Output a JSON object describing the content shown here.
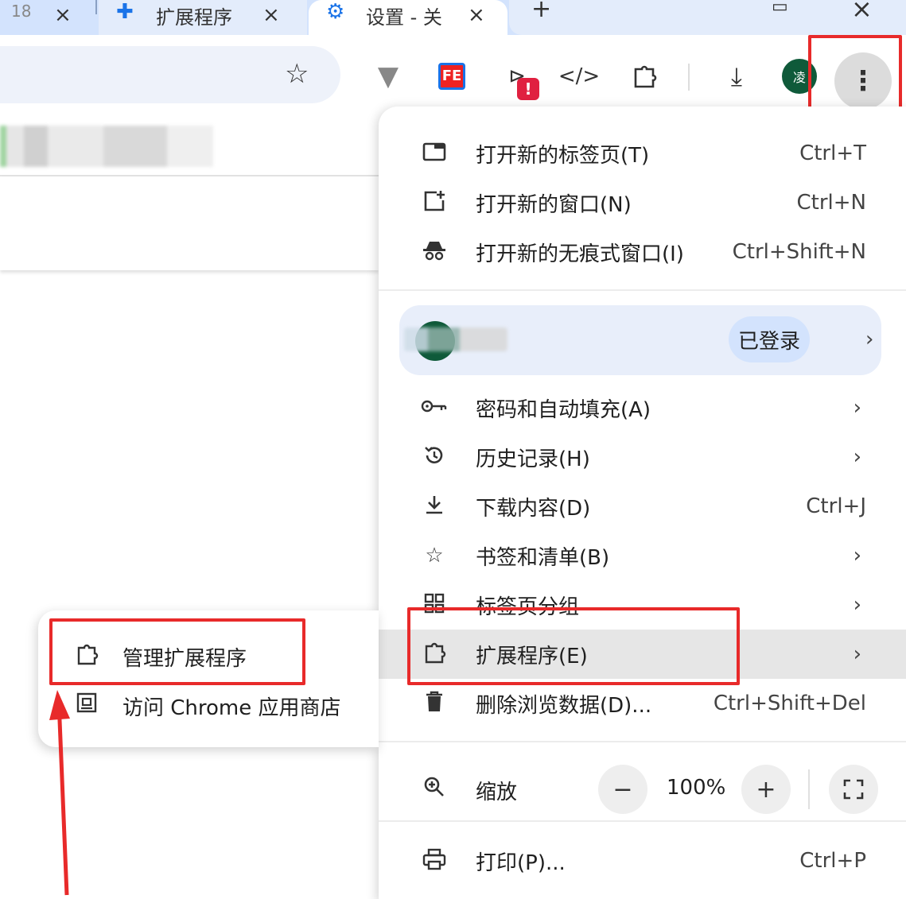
{
  "tabs": [
    {
      "label": "18",
      "close": "×"
    },
    {
      "label": "扩展程序",
      "close": "×"
    },
    {
      "label": "设置 - 关",
      "close": "×"
    }
  ],
  "tabstrip": {
    "new_tab": "+",
    "minimize": "─",
    "close": "×"
  },
  "toolbar": {
    "bookmark_star": "☆",
    "fe_label": "FE",
    "badge": "!",
    "avatar_text": "凌",
    "menu_button": "⋮"
  },
  "menu": {
    "new_tab": {
      "label": "打开新的标签页(T)",
      "shortcut": "Ctrl+T"
    },
    "new_window": {
      "label": "打开新的窗口(N)",
      "shortcut": "Ctrl+N"
    },
    "incognito": {
      "label": "打开新的无痕式窗口(I)",
      "shortcut": "Ctrl+Shift+N"
    },
    "profile": {
      "status": "已登录",
      "arrow": "›"
    },
    "passwords": {
      "label": "密码和自动填充(A)",
      "arrow": "›"
    },
    "history": {
      "label": "历史记录(H)",
      "arrow": "›"
    },
    "downloads": {
      "label": "下载内容(D)",
      "shortcut": "Ctrl+J"
    },
    "bookmarks": {
      "label": "书签和清单(B)",
      "arrow": "›"
    },
    "tab_groups": {
      "label": "标签页分组",
      "arrow": "›"
    },
    "extensions": {
      "label": "扩展程序(E)",
      "arrow": "›"
    },
    "clear_data": {
      "label": "删除浏览数据(D)...",
      "shortcut": "Ctrl+Shift+Del"
    },
    "zoom": {
      "label": "缩放",
      "minus": "−",
      "value": "100%",
      "plus": "+",
      "fullscreen": "⛶"
    },
    "print": {
      "label": "打印(P)...",
      "shortcut": "Ctrl+P"
    }
  },
  "submenu": {
    "manage": {
      "label": "管理扩展程序"
    },
    "store": {
      "label": "访问 Chrome 应用商店"
    }
  },
  "colors": {
    "highlight": "#e82a2a",
    "accent": "#d3e3fd"
  }
}
